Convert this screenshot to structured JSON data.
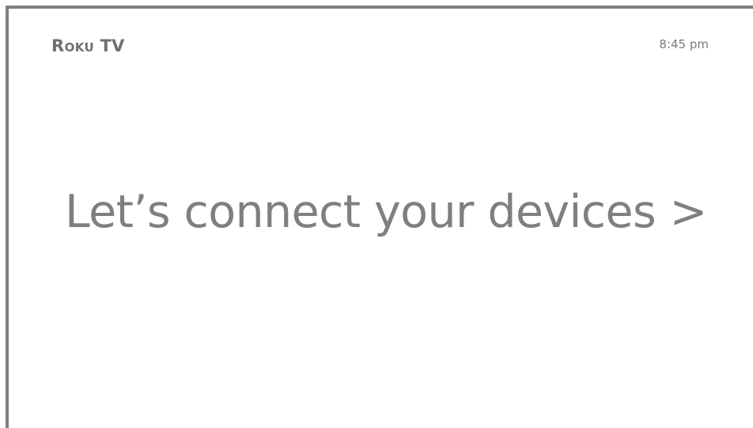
{
  "header": {
    "brand_roku": "Roku",
    "brand_tv": "TV",
    "time": "8:45 pm"
  },
  "main": {
    "headline": "Let’s connect your devices >"
  },
  "colors": {
    "frame": "#808080",
    "text": "#7f7f7f",
    "background": "#ffffff"
  }
}
